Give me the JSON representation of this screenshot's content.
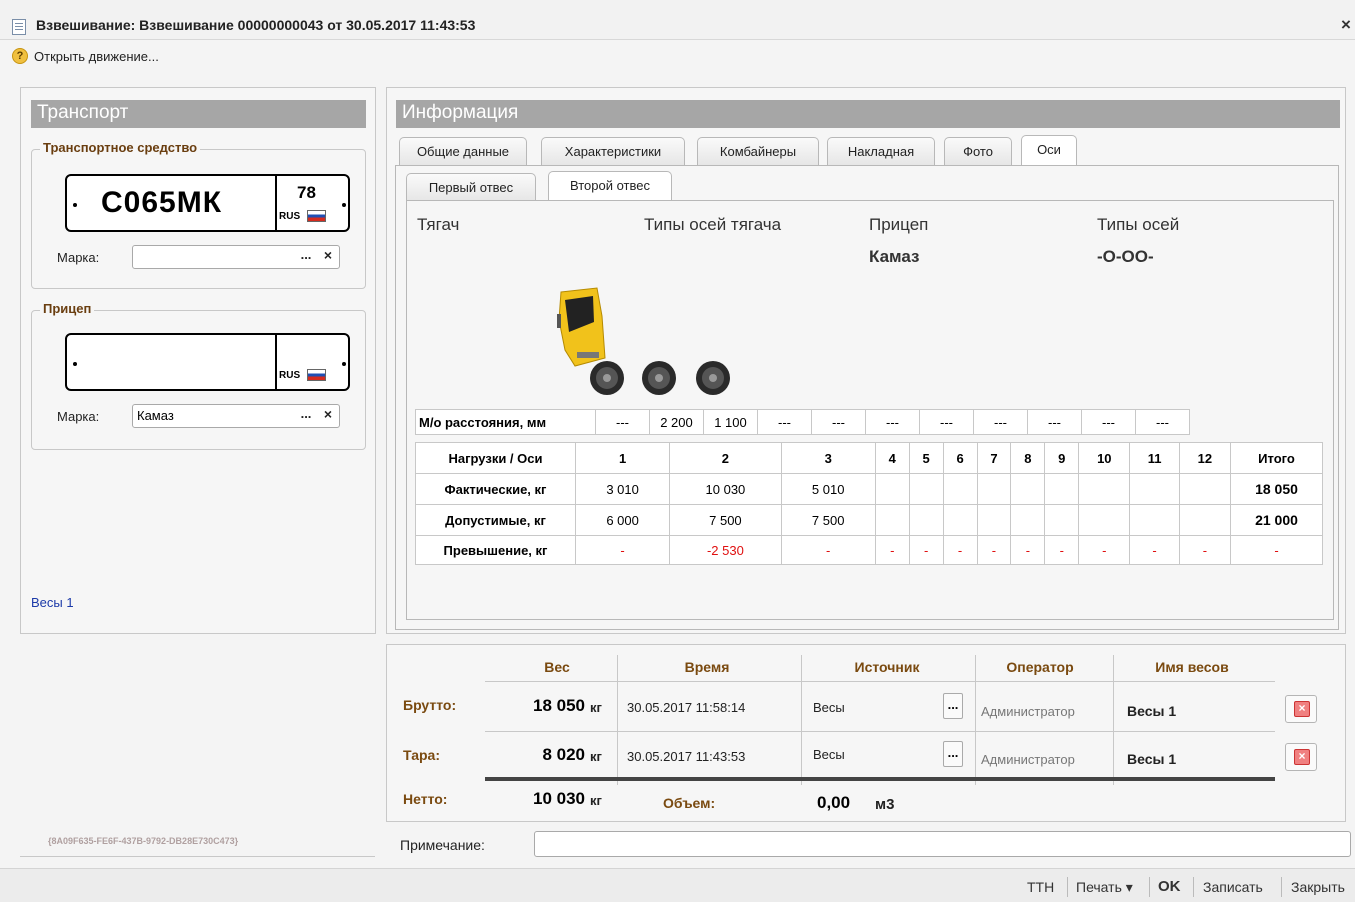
{
  "window": {
    "title": "Взвешивание: Взвешивание 00000000043 от 30.05.2017 11:43:53",
    "close": "×"
  },
  "command": {
    "open_movement": "Открыть движение...",
    "help_glyph": "?"
  },
  "left": {
    "header": "Транспорт",
    "vehicle": {
      "group_title": "Транспортное средство",
      "plate_number": "С065МК",
      "plate_region": "78",
      "plate_country": "RUS",
      "brand_label": "Марка:",
      "brand_value": ""
    },
    "trailer": {
      "group_title": "Прицеп",
      "plate_number": "",
      "plate_region": "",
      "plate_country": "RUS",
      "brand_label": "Марка:",
      "brand_value": "Камаз"
    },
    "scale_link": "Весы 1",
    "guid": "{8A09F635-FE6F-437B-9792-DB28E730C473}",
    "select_btn": "...",
    "clear_btn": "×"
  },
  "info": {
    "header": "Информация",
    "tabs": [
      "Общие данные",
      "Характеристики",
      "Комбайнеры",
      "Накладная",
      "Фото",
      "Оси"
    ],
    "active_tab": "Оси",
    "subtabs": [
      "Первый отвес",
      "Второй отвес"
    ],
    "active_subtab": "Второй отвес",
    "axes": {
      "tractor_label": "Тягач",
      "tractor_types_label": "Типы осей тягача",
      "trailer_label": "Прицеп",
      "trailer_value": "Камаз",
      "trailer_types_label": "Типы осей",
      "trailer_types_value": "-O-OO-",
      "distances_label": "М/о расстояния, мм",
      "distances": [
        "---",
        "2 200",
        "1 100",
        "---",
        "---",
        "---",
        "---",
        "---",
        "---",
        "---",
        "---"
      ],
      "table_header": [
        "Нагрузки / Оси",
        "1",
        "2",
        "3",
        "4",
        "5",
        "6",
        "7",
        "8",
        "9",
        "10",
        "11",
        "12",
        "Итого"
      ],
      "rows": [
        {
          "label": "Фактические, кг",
          "cells": [
            "3 010",
            "10 030",
            "5 010",
            "",
            "",
            "",
            "",
            "",
            "",
            "",
            "",
            ""
          ],
          "total": "18 050"
        },
        {
          "label": "Допустимые, кг",
          "cells": [
            "6 000",
            "7 500",
            "7 500",
            "",
            "",
            "",
            "",
            "",
            "",
            "",
            "",
            ""
          ],
          "total": "21 000"
        },
        {
          "label": "Превышение, кг",
          "cells": [
            "-",
            "-2 530",
            "-",
            "-",
            "-",
            "-",
            "-",
            "-",
            "-",
            "-",
            "-",
            "-"
          ],
          "total": "-"
        }
      ]
    }
  },
  "weighing": {
    "columns": [
      "Вес",
      "Время",
      "Источник",
      "Оператор",
      "Имя весов"
    ],
    "rows": [
      {
        "label": "Брутто:",
        "weight": "18 050",
        "unit": "кг",
        "time": "30.05.2017 11:58:14",
        "source": "Весы",
        "operator": "Администратор",
        "scale": "Весы 1"
      },
      {
        "label": "Тара:",
        "weight": "8 020",
        "unit": "кг",
        "time": "30.05.2017 11:43:53",
        "source": "Весы",
        "operator": "Администратор",
        "scale": "Весы 1"
      }
    ],
    "net_label": "Нетто:",
    "net_weight": "10 030",
    "net_unit": "кг",
    "volume_label": "Объем:",
    "volume_value": "0,00",
    "volume_unit": "м3",
    "note_label": "Примечание:",
    "note_value": "",
    "dots": "..."
  },
  "bottom": {
    "ttn": "ТТН",
    "print": "Печать ▾",
    "ok": "OK",
    "save": "Записать",
    "close": "Закрыть"
  },
  "colors": {
    "accent_brown": "#7a4a10",
    "header_gray": "#a6a6a6",
    "exceed_red": "#e01010",
    "link_blue": "#1c3aa8"
  }
}
